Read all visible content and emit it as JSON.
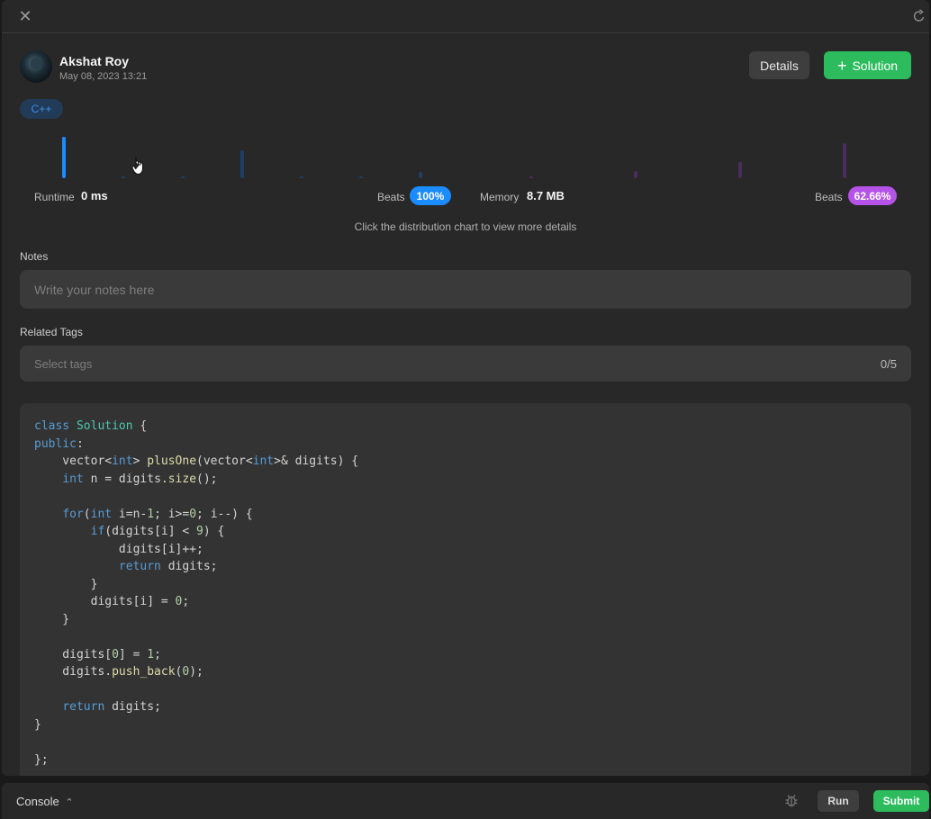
{
  "header": {
    "close_glyph": "✕"
  },
  "submission": {
    "user_name": "Akshat Roy",
    "date": "May 08, 2023 13:21",
    "details_label": "Details",
    "solution_label": "Solution",
    "language": "C++"
  },
  "stats": {
    "runtime_label": "Runtime",
    "runtime_value": "0 ms",
    "runtime_beats_label": "Beats",
    "runtime_beats_value": "100%",
    "memory_label": "Memory",
    "memory_value": "8.7 MB",
    "memory_beats_label": "Beats",
    "memory_beats_value": "62.66%",
    "hint": "Click the distribution chart to view more details"
  },
  "runtime_distribution": {
    "highlight_index": 0,
    "levels": [
      1.0,
      0.03,
      0.04,
      0.68,
      0.04,
      0.04,
      0.15,
      0.0,
      0.0,
      0.0,
      0.0,
      0.0,
      0.0
    ],
    "color": "#1a8cff",
    "dim_color": "#1f3f63"
  },
  "memory_distribution": {
    "highlight_index": 4,
    "levels": [
      0.05,
      0.18,
      0.4,
      0.84
    ],
    "color": "#b553e8",
    "dim_color": "#4a2d5c"
  },
  "notes": {
    "label": "Notes",
    "placeholder": "Write your notes here"
  },
  "tags": {
    "label": "Related Tags",
    "placeholder": "Select tags",
    "count": "0/5"
  },
  "code": {
    "lines": [
      "class Solution {",
      "public:",
      "    vector<int> plusOne(vector<int>& digits) {",
      "    int n = digits.size();",
      "",
      "    for(int i=n-1; i>=0; i--) {",
      "        if(digits[i] < 9) {",
      "            digits[i]++;",
      "            return digits;",
      "        }",
      "        digits[i] = 0;",
      "    }",
      "",
      "    digits[0] = 1;",
      "    digits.push_back(0);",
      "",
      "    return digits;",
      "}",
      "",
      "};"
    ]
  },
  "footer": {
    "console_label": "Console",
    "run_label": "Run",
    "submit_label": "Submit"
  }
}
